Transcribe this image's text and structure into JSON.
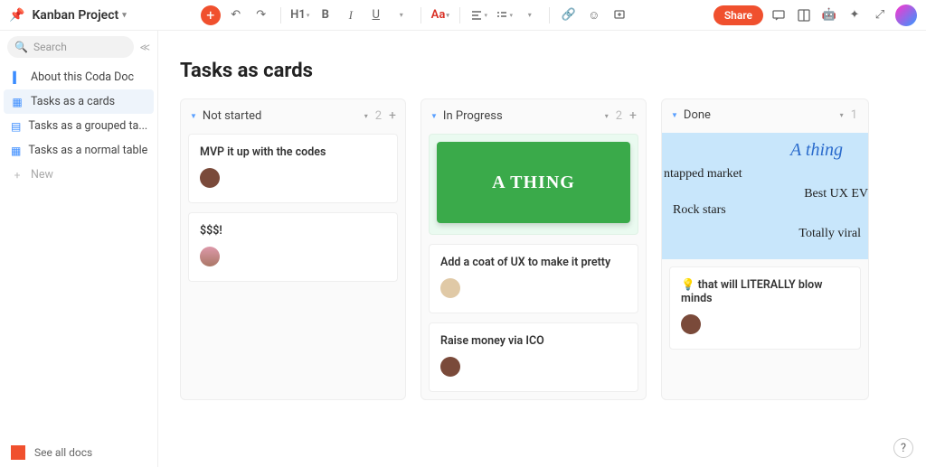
{
  "topbar": {
    "doc_title": "Kanban Project",
    "heading_label": "H1",
    "bold": "B",
    "italic": "I",
    "underline": "U",
    "text_color": "Aa",
    "share": "Share"
  },
  "sidebar": {
    "search_placeholder": "Search",
    "items": [
      {
        "label": "About this Coda Doc"
      },
      {
        "label": "Tasks as a cards"
      },
      {
        "label": "Tasks as a grouped ta..."
      },
      {
        "label": "Tasks as a normal table"
      }
    ],
    "new_label": "New",
    "footer": "See all docs"
  },
  "page": {
    "title": "Tasks as cards"
  },
  "columns": [
    {
      "name": "Not started",
      "count": "2",
      "cards": [
        {
          "title": "MVP it up with the codes"
        },
        {
          "title": "$$$!"
        }
      ]
    },
    {
      "name": "In Progress",
      "count": "2",
      "image_text": "A THING",
      "cards": [
        {
          "title": "Add a coat of UX to make it pretty"
        },
        {
          "title": "Raise money via ICO"
        }
      ]
    },
    {
      "name": "Done",
      "count": "1",
      "blue": {
        "athing": "A thing",
        "market": "ntapped market",
        "ux": "Best UX EV",
        "rock": "Rock stars",
        "viral": "Totally viral"
      },
      "cards": [
        {
          "title": "💡 that will LITERALLY blow minds"
        }
      ]
    }
  ],
  "help": "?"
}
